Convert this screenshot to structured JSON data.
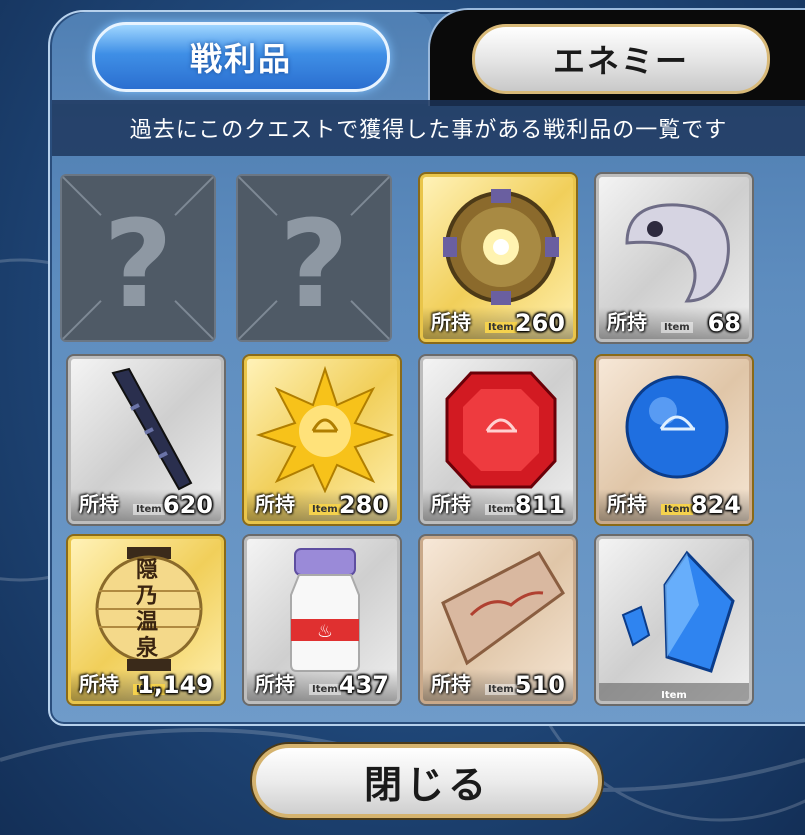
{
  "tabs": {
    "loot_label": "戦利品",
    "enemy_label": "エネミー"
  },
  "description": "過去にこのクエストで獲得した事がある戦利品の一覧です",
  "own_label": "所持",
  "item_tag": "Item",
  "unknown_glyph": "?",
  "items": [
    {
      "name": "unknown",
      "count": ""
    },
    {
      "name": "unknown",
      "count": ""
    },
    {
      "name": "gear-orb",
      "count": "260"
    },
    {
      "name": "white-magatama",
      "count": "68"
    },
    {
      "name": "dark-fang",
      "count": "620"
    },
    {
      "name": "gold-archer-piece",
      "count": "280"
    },
    {
      "name": "red-archer-gem",
      "count": "811"
    },
    {
      "name": "blue-archer-gem",
      "count": "824"
    },
    {
      "name": "onsen-lantern",
      "count": "1,149",
      "lantern_text": "隠乃温泉"
    },
    {
      "name": "milk-bottle",
      "count": "437"
    },
    {
      "name": "scroll-paper",
      "count": "510"
    },
    {
      "name": "blue-crystal",
      "count": ""
    }
  ],
  "close_label": "閉じる",
  "colors": {
    "accent_blue": "#2b6fd0",
    "gold_frame": "#e9c54a",
    "silver_frame": "#bdbdbd"
  }
}
